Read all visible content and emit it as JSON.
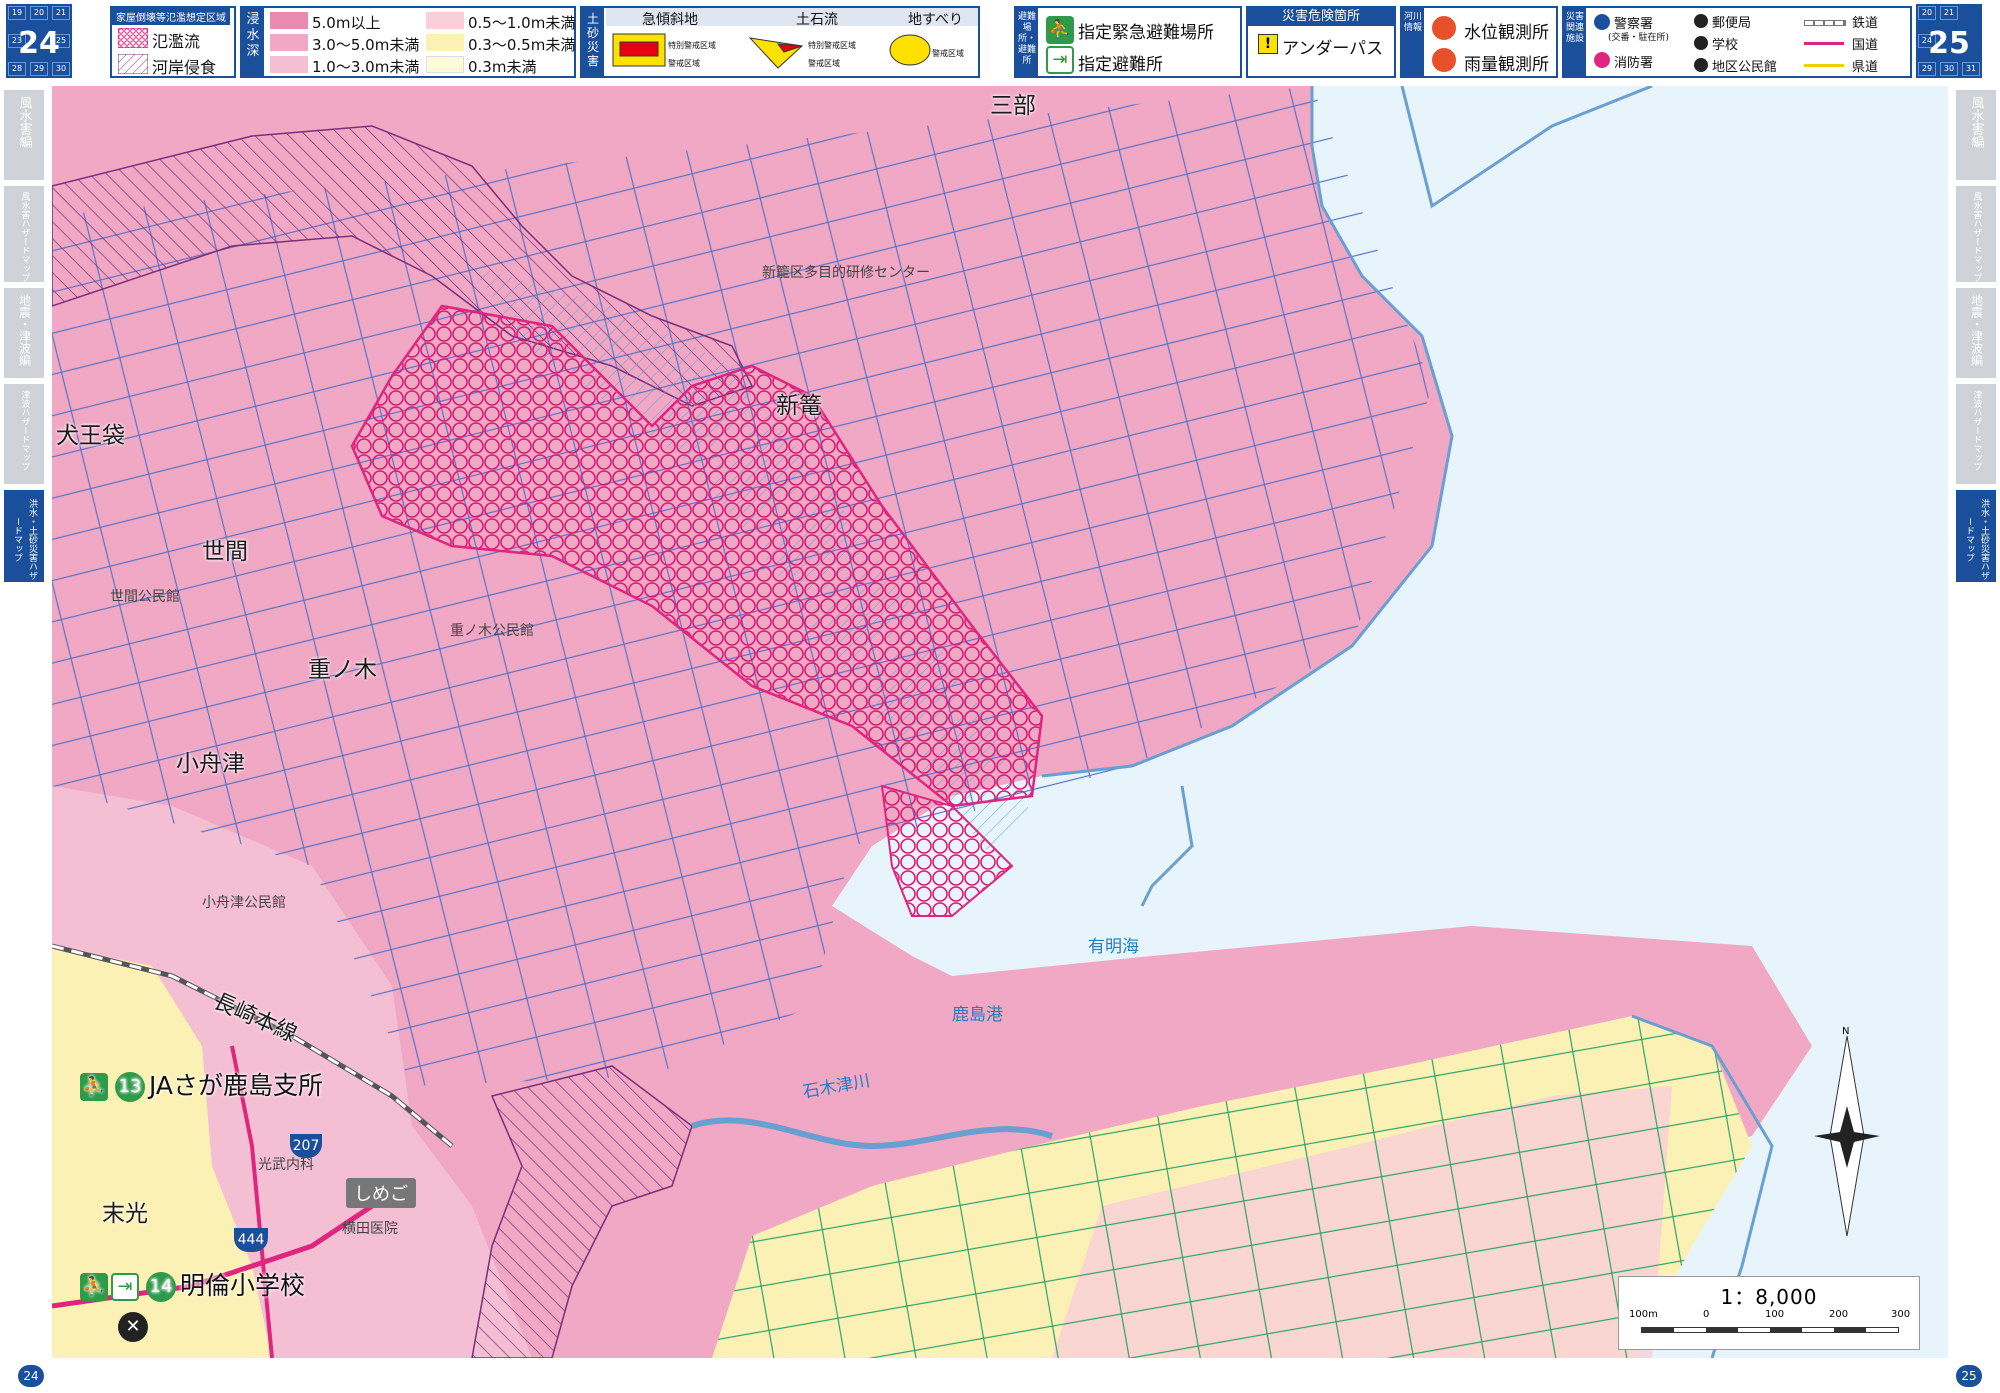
{
  "pages": {
    "left": "24",
    "right": "25"
  },
  "page_grid": {
    "left": [
      "19",
      "20",
      "21",
      "23",
      "24",
      "25",
      "28",
      "29",
      "30"
    ],
    "right": [
      "20",
      "21",
      "24",
      "25",
      "29",
      "30",
      "31"
    ]
  },
  "legend_flood": {
    "title": "家屋倒壊等氾濫想定区域",
    "overflow": "氾濫流",
    "bank_erosion": "河岸侵食"
  },
  "legend_depth": {
    "tag": "浸水深",
    "items": [
      {
        "label": "5.0m以上",
        "color": "#e98bb0"
      },
      {
        "label": "0.5～1.0m未満",
        "color": "#f9cfd8"
      },
      {
        "label": "3.0～5.0m未満",
        "color": "#f0a8c4"
      },
      {
        "label": "0.3～0.5m未満",
        "color": "#fbf1b5"
      },
      {
        "label": "1.0～3.0m未満",
        "color": "#f5bfd3"
      },
      {
        "label": "0.3m未満",
        "color": "#fefbd8"
      }
    ]
  },
  "legend_sediment": {
    "tag": "土砂災害",
    "columns": [
      "急傾斜地",
      "土石流",
      "地すべり"
    ],
    "sub_special": "特別警戒区域",
    "sub_warning": "警戒区域",
    "colors": {
      "special": "#e60012",
      "warning": "#ffe100"
    }
  },
  "legend_evac": {
    "tag": "避難場所・避難所",
    "emergency": "指定緊急避難場所",
    "shelter": "指定避難所"
  },
  "legend_danger": {
    "title": "災害危険箇所",
    "item": "アンダーパス"
  },
  "legend_river": {
    "tag": "河川情報",
    "water_level": "水位観測所",
    "rain": "雨量観測所"
  },
  "legend_facility": {
    "tag": "災害関連施設",
    "police": "警察署",
    "police_sub": "(交番・駐在所)",
    "fire": "消防署",
    "post": "郵便局",
    "school": "学校",
    "hall": "地区公民館",
    "rail": "鉄道",
    "national_road": "国道",
    "pref_road": "県道"
  },
  "side_tabs_left": [
    "風水害編",
    "風水害ハザードマップ",
    "地震・津波編",
    "津波ハザードマップ",
    "洪水・土砂災害ハザードマップ"
  ],
  "side_tabs_right": [
    "風水害編",
    "風水害ハザードマップ",
    "地震・津波編",
    "津波ハザードマップ",
    "洪水・土砂災害ハザードマップ"
  ],
  "map": {
    "place_names": [
      "三部",
      "新篭",
      "犬王袋",
      "世間",
      "重ノ木",
      "小舟津",
      "末光"
    ],
    "small_labels": [
      "新籠区多目的研修センター",
      "世間公民館",
      "重ノ木公民館",
      "小舟津公民館",
      "光武内科",
      "横田医院"
    ],
    "sea_name": "有明海",
    "port_name": "鹿島港",
    "river_name": "石木津川",
    "railway_label": "長崎本線",
    "underpass_label": "しめご",
    "route_207": "207",
    "route_444": "444",
    "facility_13": {
      "num": "13",
      "name": "JAさが鹿島支所"
    },
    "facility_14": {
      "num": "14",
      "name": "明倫小学校"
    }
  },
  "scale": {
    "ratio": "1：8,000",
    "ticks": [
      "100m",
      "0",
      "100",
      "200",
      "300"
    ]
  },
  "compass": {
    "north": "N"
  },
  "colors": {
    "blue_accent": "#1a4f9c",
    "depth_3_5": "#f0a8c4",
    "depth_1_3": "#f5bfd3",
    "depth_05_1": "#f9cfd8",
    "depth_03_05": "#fbf1b5",
    "depth_lt03": "#fefbd8",
    "sea": "#e7f4fb",
    "overflow_zone": "#e0257e"
  }
}
